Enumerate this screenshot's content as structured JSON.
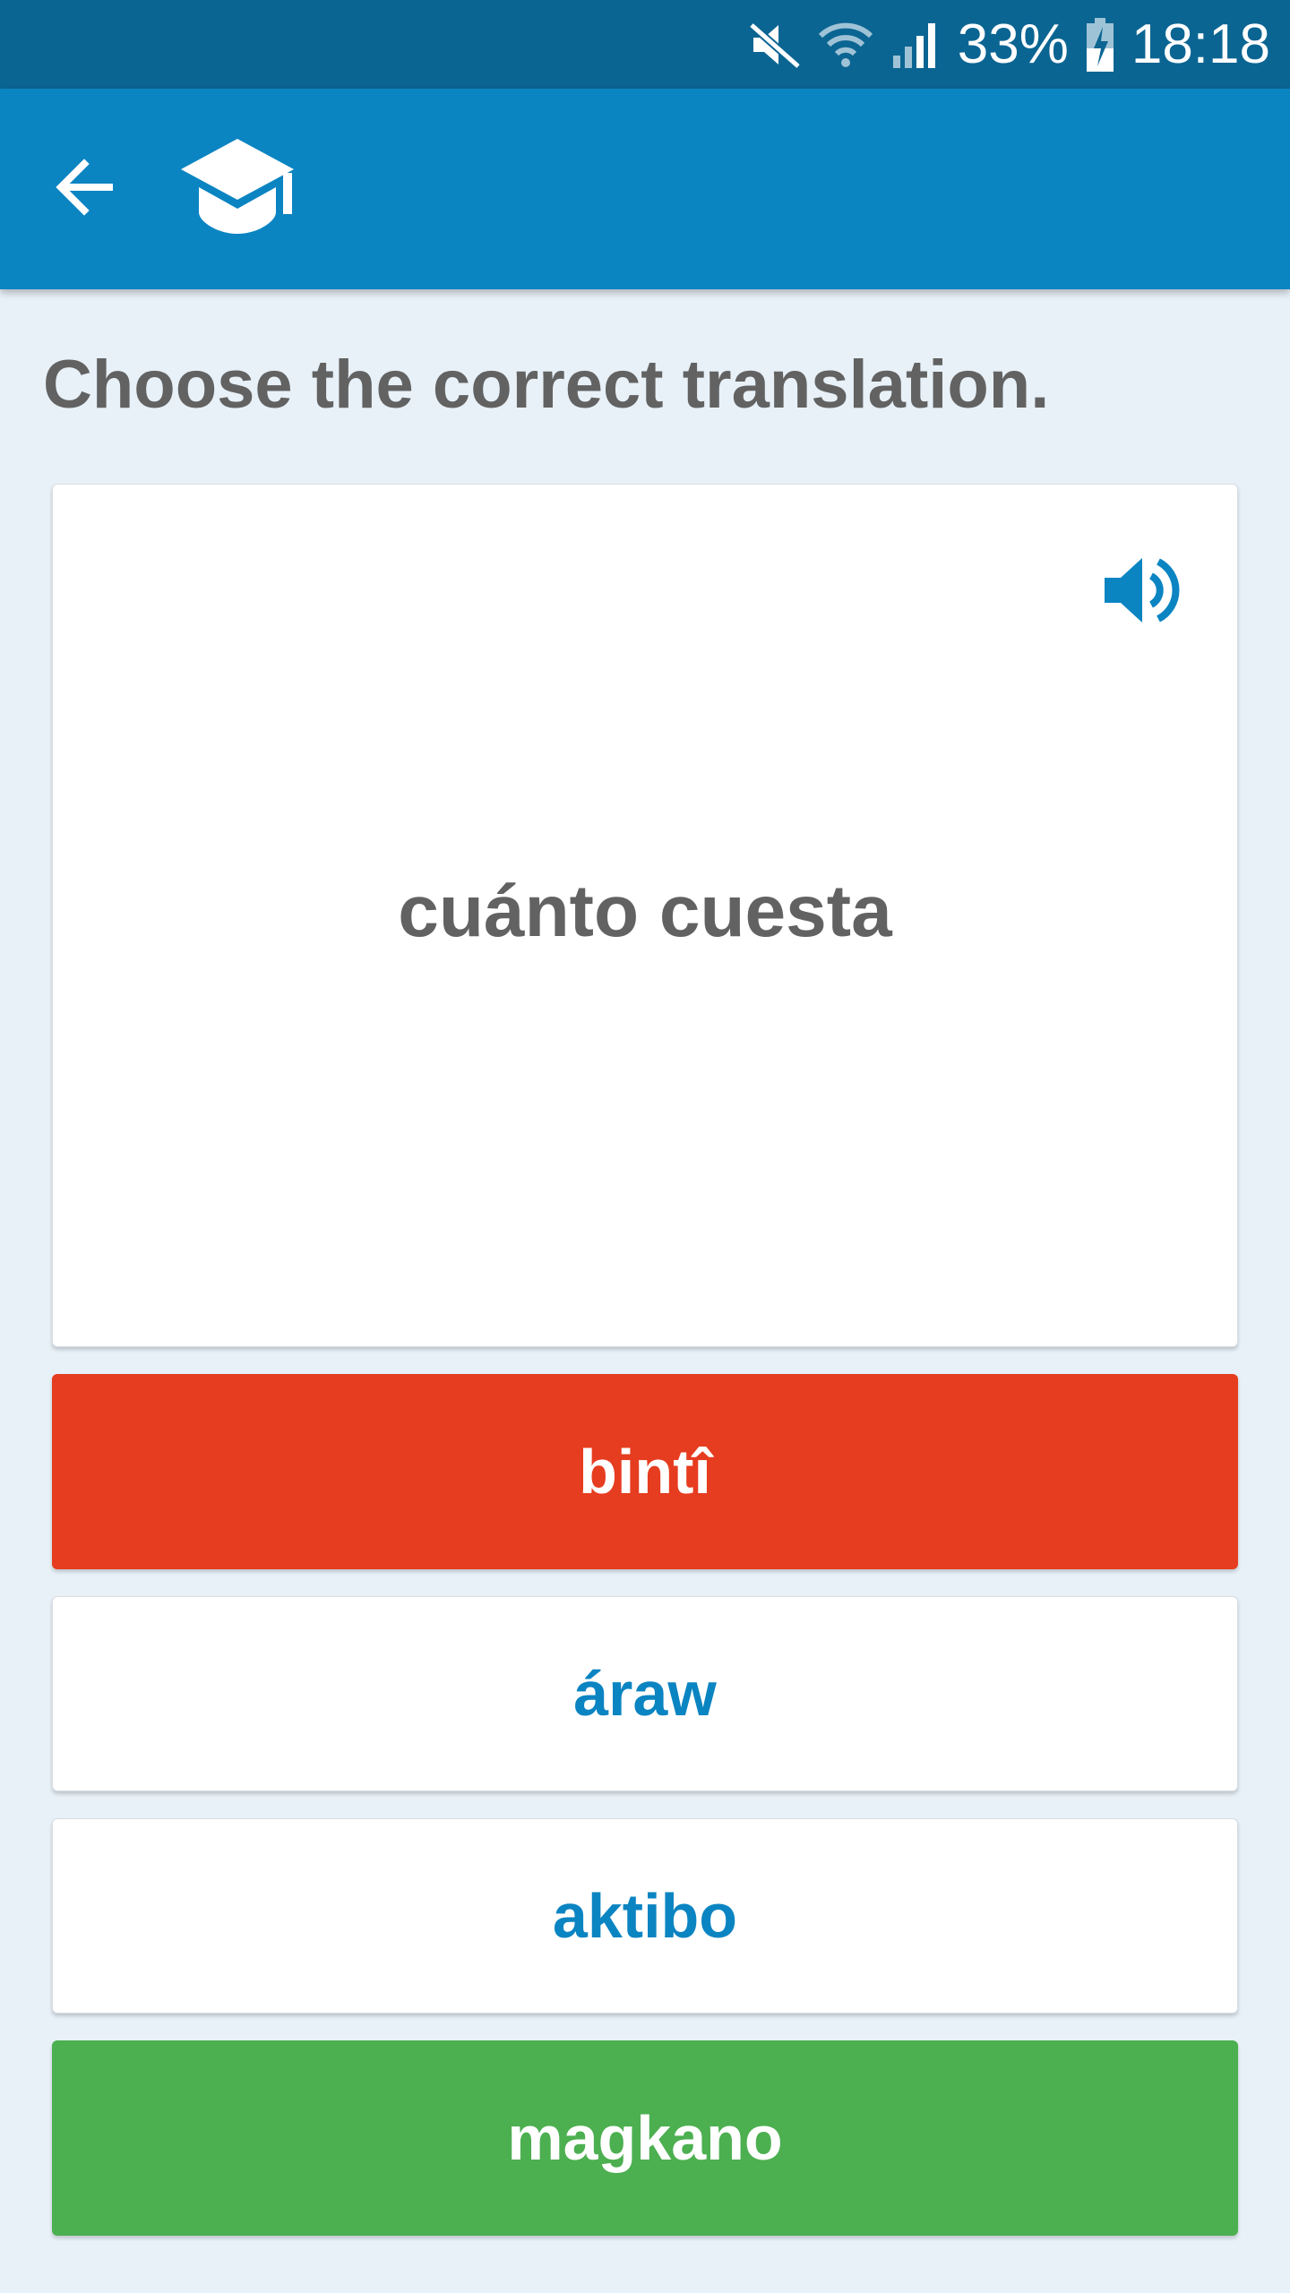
{
  "status_bar": {
    "battery_percent": "33%",
    "time": "18:18",
    "icons": [
      "mute-icon",
      "wifi-icon",
      "signal-icon",
      "battery-charging-icon"
    ]
  },
  "app_bar": {
    "icons": [
      "back-arrow-icon",
      "graduation-cap-icon"
    ],
    "color": "#0b84c2"
  },
  "quiz": {
    "instruction": "Choose the correct translation.",
    "prompt_word": "cuánto cuesta",
    "answers": [
      {
        "label": "bintî",
        "state": "wrong",
        "color": "#e63c1f"
      },
      {
        "label": "áraw",
        "state": "neutral",
        "color": "#ffffff"
      },
      {
        "label": "aktibo",
        "state": "neutral",
        "color": "#ffffff"
      },
      {
        "label": "magkano",
        "state": "correct",
        "color": "#4caf50"
      }
    ]
  }
}
